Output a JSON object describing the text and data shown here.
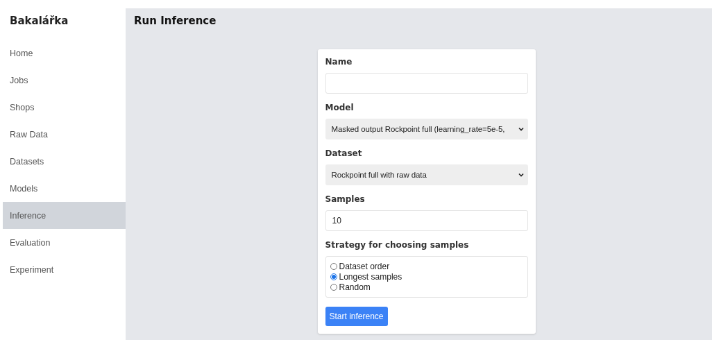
{
  "sidebar": {
    "title": "Bakalářka",
    "items": [
      {
        "label": "Home",
        "selected": false
      },
      {
        "label": "Jobs",
        "selected": false
      },
      {
        "label": "Shops",
        "selected": false
      },
      {
        "label": "Raw Data",
        "selected": false
      },
      {
        "label": "Datasets",
        "selected": false
      },
      {
        "label": "Models",
        "selected": false
      },
      {
        "label": "Inference",
        "selected": true
      },
      {
        "label": "Evaluation",
        "selected": false
      },
      {
        "label": "Experiment",
        "selected": false
      }
    ]
  },
  "page": {
    "title": "Run Inference"
  },
  "form": {
    "fields": [
      {
        "kind": "text",
        "label": "Name"
      },
      {
        "kind": "select",
        "label": "Model",
        "value": "Masked output Rockpoint full (learning_rate=5e-5,"
      },
      {
        "kind": "select",
        "label": "Dataset",
        "value": "Rockpoint full with raw data"
      },
      {
        "kind": "text",
        "label": "Samples",
        "value": "10"
      },
      {
        "kind": "radio",
        "label": "Strategy for choosing samples",
        "options": [
          {
            "label": "Dataset order",
            "selected": false
          },
          {
            "label": "Longest samples",
            "selected": true
          },
          {
            "label": "Random",
            "selected": false
          }
        ]
      }
    ],
    "submit": "Start inference"
  }
}
